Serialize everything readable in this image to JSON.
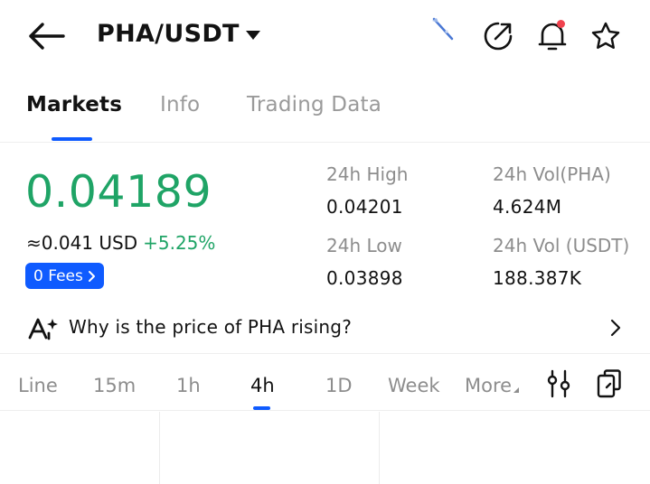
{
  "colors": {
    "green": "#1fa466",
    "blue": "#0f5bff",
    "red": "#f0434f",
    "dark": "#121212",
    "gray": "#8d8d8d"
  },
  "header": {
    "pair": "PHA/USDT",
    "icons": [
      "back-arrow-icon",
      "caret-down-icon",
      "sparkle-icon",
      "share-icon",
      "bell-icon",
      "star-icon"
    ]
  },
  "tabs": [
    {
      "label": "Markets",
      "active": true
    },
    {
      "label": "Info",
      "active": false
    },
    {
      "label": "Trading Data",
      "active": false
    }
  ],
  "market": {
    "price": "0.04189",
    "approx": "≈0.041 USD",
    "change": "+5.25%",
    "fees_label": "0 Fees"
  },
  "stats": {
    "high_label": "24h High",
    "high_value": "0.04201",
    "low_label": "24h Low",
    "low_value": "0.03898",
    "vol_base_label": "24h Vol(PHA)",
    "vol_base_value": "4.624M",
    "vol_quote_label": "24h Vol (USDT)",
    "vol_quote_value": "188.387K"
  },
  "insight": {
    "text": "Why is the price of PHA rising?",
    "icon": "ai-sparkle-icon"
  },
  "intervals": [
    {
      "label": "Line",
      "active": false
    },
    {
      "label": "15m",
      "active": false
    },
    {
      "label": "1h",
      "active": false
    },
    {
      "label": "4h",
      "active": true
    },
    {
      "label": "1D",
      "active": false
    },
    {
      "label": "Week",
      "active": false
    },
    {
      "label": "More",
      "active": false
    }
  ],
  "tools": [
    "indicator-settings-icon",
    "copy-layout-icon"
  ]
}
